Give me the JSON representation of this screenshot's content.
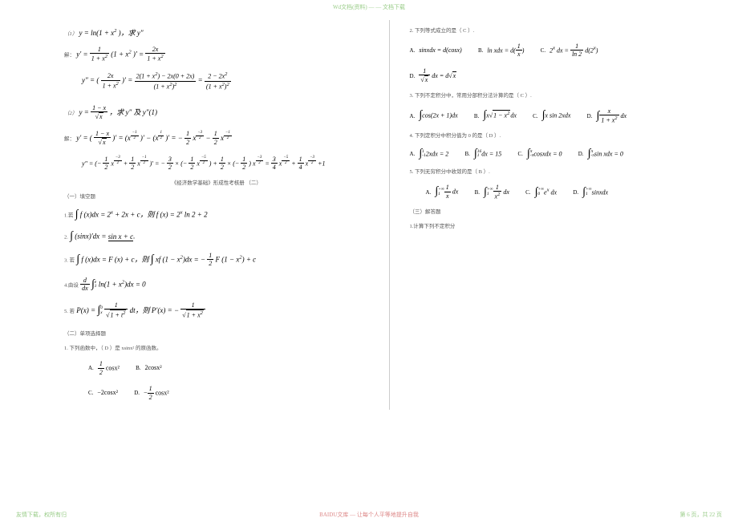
{
  "header_text": "Wd文档(资料)  — —  文档下载",
  "footer_left": "友情下载，权所有归",
  "footer_center": "BAIDU文库 — 让每个人平等地提升自我",
  "footer_right": "第 6 页，共 22 页",
  "left": {
    "l1a": "（1）",
    "l1b": "y = ln(1 + x",
    "l1c": ")，求 y″",
    "l2a": "解：",
    "l2b": "y′ =",
    "l2c": "1",
    "l2d": "1 + x",
    "l2e": "(1 + x",
    "l2f": ")′ =",
    "l2g": "2x",
    "l2h": "1 + x",
    "l3a": "y″ = (",
    "l3b": "2x",
    "l3c": "1 + x",
    "l3d": ")′ =",
    "l3e": "2(1 + x",
    "l3f": ") − 2x(0 + 2x)",
    "l3g": "(1 + x",
    "l3h": ")",
    "l3i": "=",
    "l3j": "2 − 2x",
    "l3k": "(1 + x",
    "l3l": ")",
    "l4a": "（2）",
    "l4b": "y =",
    "l4c": "1 − x",
    "l4d": "x",
    "l4e": "，求 y″ 及 y″(1)",
    "l5a": "解：",
    "l5b": "y′ = (",
    "l5c": "1 − x",
    "l5d": "x",
    "l5e": ")′ = (x",
    "l5f": ")′ − (x",
    "l5g": ")′ = −",
    "l5h": "1",
    "l5i": "2",
    "l5j": "x",
    "l5k": " −",
    "l5l": "1",
    "l5m": "2",
    "l5n": "x",
    "l6a": "y″ = (−",
    "l6b": "1",
    "l6c": "2",
    "l6d": "x",
    "l6e": " +",
    "l6f": "1",
    "l6g": "2",
    "l6h": "x",
    "l6i": ")′ = −",
    "l6j": "3",
    "l6k": "2",
    "l6l": "× (−",
    "l6m": "1",
    "l6n": "2",
    "l6o": "x",
    "l6p": ") +",
    "l6q": "1",
    "l6r": "2",
    "l6s": "× (−",
    "l6t": "1",
    "l6u": "2",
    "l6v": ") x",
    "l6w": " =",
    "l6x": "3",
    "l6y": "4",
    "l6z": "x",
    "l6aa": " +",
    "l6ab": "1",
    "l6ac": "4",
    "l6ad": "x",
    "l6ae": "+1",
    "mid": "《经济数学基础》形成性考核册       （二）",
    "sec1": "（一）填空题",
    "f1a": "1.若",
    "f1b": "f (x)dx = 2",
    "f1c": " + 2x + c，则 f (x) = 2",
    "f1d": " ln 2 + 2",
    "f2a": "2.",
    "f2b": "(sinx)′dx =",
    "f2c": "sin x + c",
    "f3a": "3. 若",
    "f3b": "f (x)dx = F (x) + c，则",
    "f3c": "xf (1 − x",
    "f3d": ")dx = −",
    "f3e": "1",
    "f3f": "2",
    "f3g": " F (1 − x",
    "f3h": ") + c",
    "f4a": "4.由设",
    "f4b": "d",
    "f4c": "dx",
    "f4d": "ln(1 + x",
    "f4e": ")dx = 0",
    "f5a": "5. 若",
    "f5b": "P(x) =",
    "f5c": "1",
    "f5d": "1 + t",
    "f5e": "dt，则 P′(x) = −",
    "f5f": "1",
    "f5g": "1 + x",
    "sec2": "（二）单项选择题",
    "q1": "1. 下列函数中，（    D    ）是 xsinx² 的原函数。",
    "q1a": "A.",
    "q1av": "cosx²",
    "q1af": "1",
    "q1afd": "2",
    "q1b": "B.",
    "q1bv": "2cosx²",
    "q1c": "C.",
    "q1cv": "−2cosx²",
    "q1d": "D.",
    "q1dv": "−",
    "q1df": "1",
    "q1dfd": "2",
    "q1de": "cosx²"
  },
  "right": {
    "q2": "2. 下列等式成立的是（    C    ）.",
    "r2a": "A.",
    "r2av": "sinxdx = d(cosx)",
    "r2b": "B.",
    "r2bv": "ln xdx = d(",
    "r2bf": "1",
    "r2bfd": "x",
    "r2be": ")",
    "r2c": "C.",
    "r2cv": "2",
    "r2ce": " dx =",
    "r2cf": "1",
    "r2cfd": "ln 2",
    "r2cg": " d(2",
    "r2ch": ")",
    "r2d": "D.",
    "r2df": "1",
    "r2dfd": "x",
    "r2de": " dx = d",
    "r2dg": "x",
    "q3": "3. 下列不定积分中，常用分部积分法计算的是（    C    ）.",
    "r3a": "A.",
    "r3av": "cos(2x + 1)dx",
    "r3b": "B.",
    "r3bv": "x",
    "r3bs": "1 − x",
    "r3be": "dx",
    "r3c": "C.",
    "r3cv": "x sin 2xdx",
    "r3d": "D.",
    "r3df": "x",
    "r3dfd": "1 + x",
    "r3de": " dx",
    "q4": "4. 下列定积分中积分值为    0 的是（    D    ）.",
    "r4a": "A.",
    "r4av": "2xdx = 2",
    "r4b": "B.",
    "r4bv": "dx = 15",
    "r4c": "C.",
    "r4cv": "cosxdx = 0",
    "r4d": "D.",
    "r4dv": "sin xdx = 0",
    "q5": "5. 下列无穷积分中收敛的是（    B    ）.",
    "r5a": "A.",
    "r5af": "1",
    "r5afd": "x",
    "r5ae": " dx",
    "r5b": "B.",
    "r5bf": "1",
    "r5bfd": "x",
    "r5be": " dx",
    "r5c": "C.",
    "r5cv": "e",
    "r5ce": " dx",
    "r5d": "D.",
    "r5dv": "sinxdx",
    "sec3": "（三）解答题",
    "q6": "1.计算下列不定积分"
  }
}
